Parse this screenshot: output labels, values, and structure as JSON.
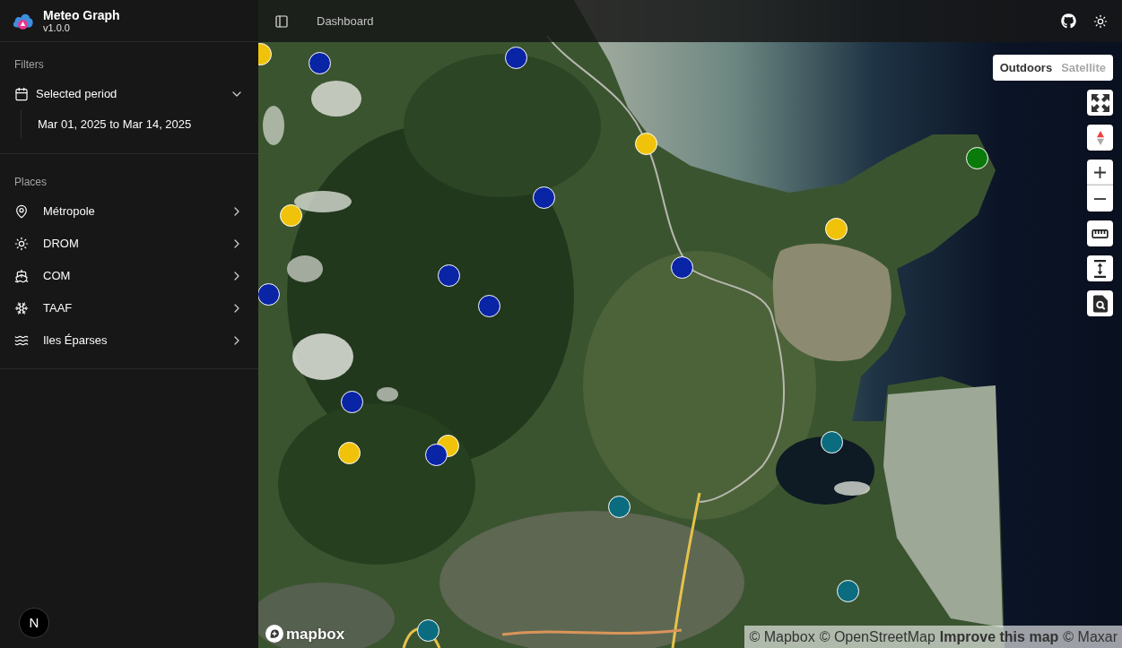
{
  "sidebar": {
    "app": {
      "title": "Meteo Graph",
      "version": "v1.0.0"
    },
    "groups": [
      {
        "label": "Filters",
        "items": [
          {
            "kind": "filter",
            "label": "Selected period",
            "expanded": true,
            "children": [
              {
                "label": "Mar 01, 2025 to Mar 14, 2025"
              }
            ]
          }
        ]
      },
      {
        "label": "Places",
        "items": [
          {
            "kind": "place",
            "label": "Métropole",
            "expanded": false
          },
          {
            "kind": "place",
            "label": "DROM",
            "expanded": false
          },
          {
            "kind": "place",
            "label": "COM",
            "expanded": false
          },
          {
            "kind": "place",
            "label": "TAAF",
            "expanded": false
          },
          {
            "kind": "place",
            "label": "Iles Éparses",
            "expanded": false
          }
        ]
      }
    ],
    "dev_indicator": {
      "label": "N"
    }
  },
  "topbar": {
    "breadcrumb": "Dashboard"
  },
  "map": {
    "styles": [
      {
        "label": "Outdoors",
        "selected": false
      },
      {
        "label": "Satellite",
        "selected": true
      }
    ],
    "markers": [
      {
        "color": "#f0c30a"
      },
      {
        "color": "#0a24a6"
      },
      {
        "color": "#0a24a6"
      },
      {
        "color": "#f0c30a"
      },
      {
        "color": "#0a7a0a"
      },
      {
        "color": "#f0c30a"
      },
      {
        "color": "#0a24a6"
      },
      {
        "color": "#f0c30a"
      },
      {
        "color": "#0a24a6"
      },
      {
        "color": "#0a24a6"
      },
      {
        "color": "#0a24a6"
      },
      {
        "color": "#0a24a6"
      },
      {
        "color": "#0a24a6"
      },
      {
        "color": "#f0c30a"
      },
      {
        "color": "#f0c30a"
      },
      {
        "color": "#0a24a6"
      },
      {
        "color": "#0b6c80"
      },
      {
        "color": "#0b6c80"
      },
      {
        "color": "#0b6c80"
      },
      {
        "color": "#0b6c80"
      }
    ],
    "logo": "mapbox",
    "attribution": [
      {
        "kind": "text",
        "text": "© Mapbox"
      },
      {
        "kind": "text",
        "text": "© OpenStreetMap"
      },
      {
        "kind": "link",
        "text": "Improve this map"
      },
      {
        "kind": "text",
        "text": "© Maxar"
      }
    ]
  }
}
